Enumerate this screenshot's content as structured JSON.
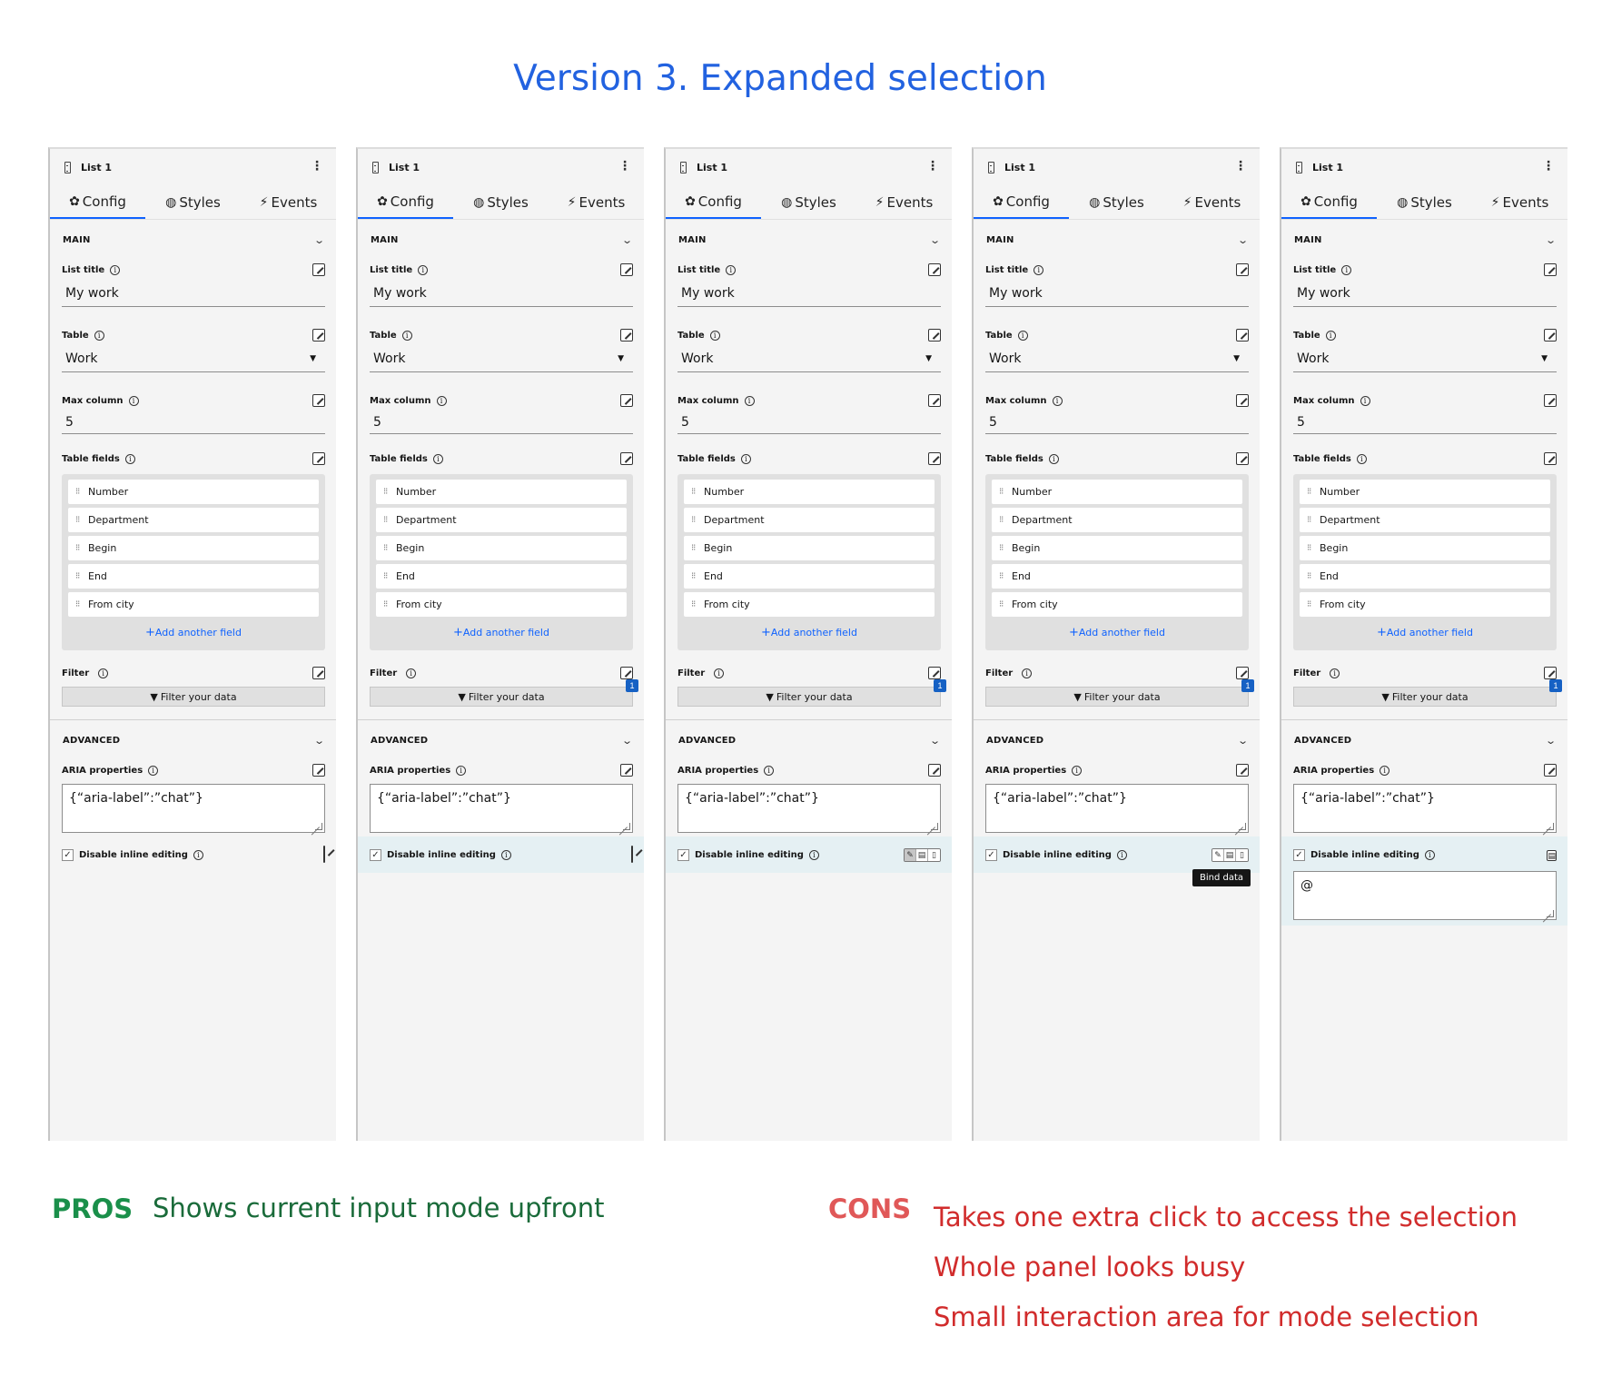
{
  "title": "Version 3. Expanded selection",
  "panel": {
    "name": "List 1",
    "kebab": "⋮",
    "tabs": [
      {
        "label": "Config",
        "icon": "gear-icon",
        "glyph": "✿"
      },
      {
        "label": "Styles",
        "icon": "palette-icon",
        "glyph": "◍"
      },
      {
        "label": "Events",
        "icon": "lightning-icon",
        "glyph": "⚡"
      }
    ],
    "main_section": "MAIN",
    "list_title_label": "List title",
    "list_title_value": "My work",
    "table_label": "Table",
    "table_value": "Work",
    "max_column_label": "Max column",
    "max_column_value": "5",
    "table_fields_label": "Table fields",
    "fields": [
      "Number",
      "Department",
      "Begin",
      "End",
      "From city"
    ],
    "add_field": "Add another field",
    "filter_label": "Filter",
    "filter_button": "Filter your data",
    "filter_badge": "1",
    "advanced_section": "ADVANCED",
    "aria_label": "ARIA properties",
    "aria_value": "{“aria-label”:”chat”}",
    "inline_label": "Disable inline editing",
    "tooltip": "Bind data",
    "at_value": "@"
  },
  "pros": {
    "label": "PROS",
    "items": [
      "Shows current input mode upfront"
    ]
  },
  "cons": {
    "label": "CONS",
    "items": [
      "Takes one extra click to access the selection",
      "Whole panel looks busy",
      "Small interaction area for mode selection"
    ]
  },
  "colors": {
    "title": "#2262e0",
    "accent": "#0f62fe",
    "pros": "#1a8f4a",
    "cons": "#d12c2c",
    "highlight": "#e5f0f3"
  }
}
